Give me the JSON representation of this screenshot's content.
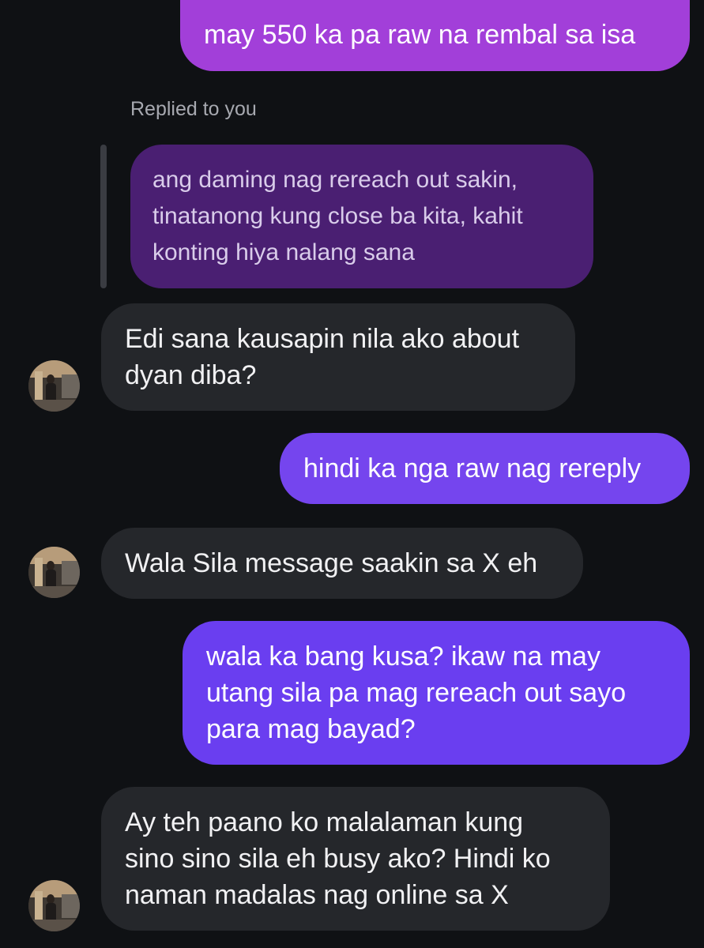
{
  "conversation": {
    "messages": [
      {
        "direction": "outgoing",
        "text": "may 550 ka pa raw na rembal sa isa"
      },
      {
        "direction": "incoming",
        "text": "Edi sana kausapin nila ako about\ndyan diba?",
        "replied_label": "Replied to you",
        "quoted_text": "ang daming nag rereach out sakin,\ntinatanong kung close ba kita, kahit\nkonting hiya nalang sana"
      },
      {
        "direction": "outgoing",
        "text": "hindi ka nga raw nag rereply"
      },
      {
        "direction": "incoming",
        "text": "Wala Sila message saakin sa X eh"
      },
      {
        "direction": "outgoing",
        "text": "wala ka bang kusa? ikaw na may\nutang sila pa mag rereach out sayo\npara mag bayad?"
      },
      {
        "direction": "incoming",
        "text": "Ay teh paano ko malalaman kung\nsino sino sila eh busy ako? Hindi ko\nnaman madalas nag online sa X"
      }
    ]
  },
  "colors": {
    "background": "#0f1114",
    "incoming_bubble": "#25272b",
    "outgoing_top": "#a23fd9",
    "outgoing_mid": "#7545ee",
    "outgoing_bottom": "#6a3ef0",
    "quoted_bubble": "#4a1f72"
  },
  "icons": {
    "avatar": "user-avatar-photo"
  }
}
